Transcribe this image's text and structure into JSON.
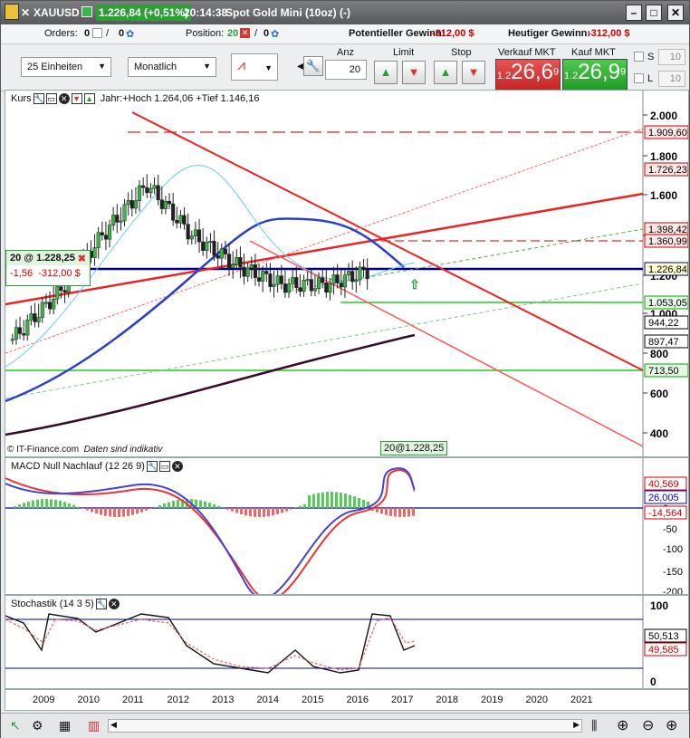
{
  "title": {
    "symbol": "XAUUSD",
    "price_change": "1.226,84 (+0,51%)",
    "time": "20:14:38",
    "name": "Spot Gold Mini (10oz) (-)",
    "pot_gain_label": "Potentieller Gewinn:",
    "pot_gain": "-312,00 $",
    "today_gain_label": "Heutiger Gewinn:",
    "today_gain": "-312,00 $"
  },
  "orders": {
    "orders_label": "Orders:",
    "orders_a": "0",
    "orders_b": "0",
    "position_label": "Position:",
    "position_a": "20",
    "position_b": "0"
  },
  "toolbar": {
    "units": "25 Einheiten",
    "period": "Monatlich",
    "anz_label": "Anz",
    "anz_value": "20",
    "limit_label": "Limit",
    "stop_label": "Stop",
    "sell_label": "Verkauf MKT",
    "buy_label": "Kauf MKT",
    "sell_small": "1.2",
    "sell_big": "26,6",
    "sell_sup": "9",
    "buy_small": "1.2",
    "buy_big": "26,9",
    "buy_sup": "9",
    "s_label": "S",
    "s_value": "10",
    "l_label": "L",
    "l_value": "10"
  },
  "main": {
    "title": "Kurs",
    "info": "Jahr:+Hoch 1.264,06 +Tief 1.146,16",
    "pos_label": "20 @ 1.228,25",
    "pos_pts": "-1,56",
    "pos_pl": "-312,00 $",
    "footer": "© IT-Finance.com",
    "footer_note": "Daten sind indikativ",
    "marker": "20@1.228,25",
    "yticks": [
      "2.000",
      "1.800",
      "1.600",
      "1.400",
      "1.200",
      "1.000",
      "800",
      "600",
      "400"
    ],
    "levels": [
      {
        "v": "1.909,60",
        "c": "#c00"
      },
      {
        "v": "1.726,23",
        "c": "#c00"
      },
      {
        "v": "1.398,42",
        "c": "#c00"
      },
      {
        "v": "1.360,99",
        "c": "#c00"
      },
      {
        "v": "1.226,84",
        "c": "#00a"
      },
      {
        "v": "1.053,05",
        "c": "#0a0"
      },
      {
        "v": "944,22",
        "c": "#000"
      },
      {
        "v": "897,47",
        "c": "#000"
      },
      {
        "v": "713,50",
        "c": "#0a0"
      }
    ]
  },
  "macd": {
    "title": "MACD Null Nachlauf (12 26 9)",
    "yticks": [
      "0",
      "-50",
      "-100",
      "-150",
      "-200"
    ],
    "val1": "40,569",
    "val2": "26,005",
    "val3": "-14,564"
  },
  "stoch": {
    "title": "Stochastik (14 3 5)",
    "yticks": [
      "100",
      "0"
    ],
    "val1": "50,513",
    "val2": "49,585"
  },
  "xaxis": [
    "2009",
    "2010",
    "2011",
    "2012",
    "2013",
    "2014",
    "2015",
    "2016",
    "2017",
    "2018",
    "2019",
    "2020",
    "2021"
  ],
  "chart_data": {
    "type": "line",
    "title": "XAUUSD",
    "x": [
      "2009",
      "2010",
      "2011",
      "2012",
      "2013",
      "2014",
      "2015",
      "2016",
      "2017"
    ],
    "series": [
      {
        "name": "Kurs",
        "values": [
          870,
          1100,
          1400,
          1650,
          1400,
          1250,
          1150,
          1150,
          1226
        ]
      }
    ],
    "ylim": [
      350,
      2100
    ]
  }
}
